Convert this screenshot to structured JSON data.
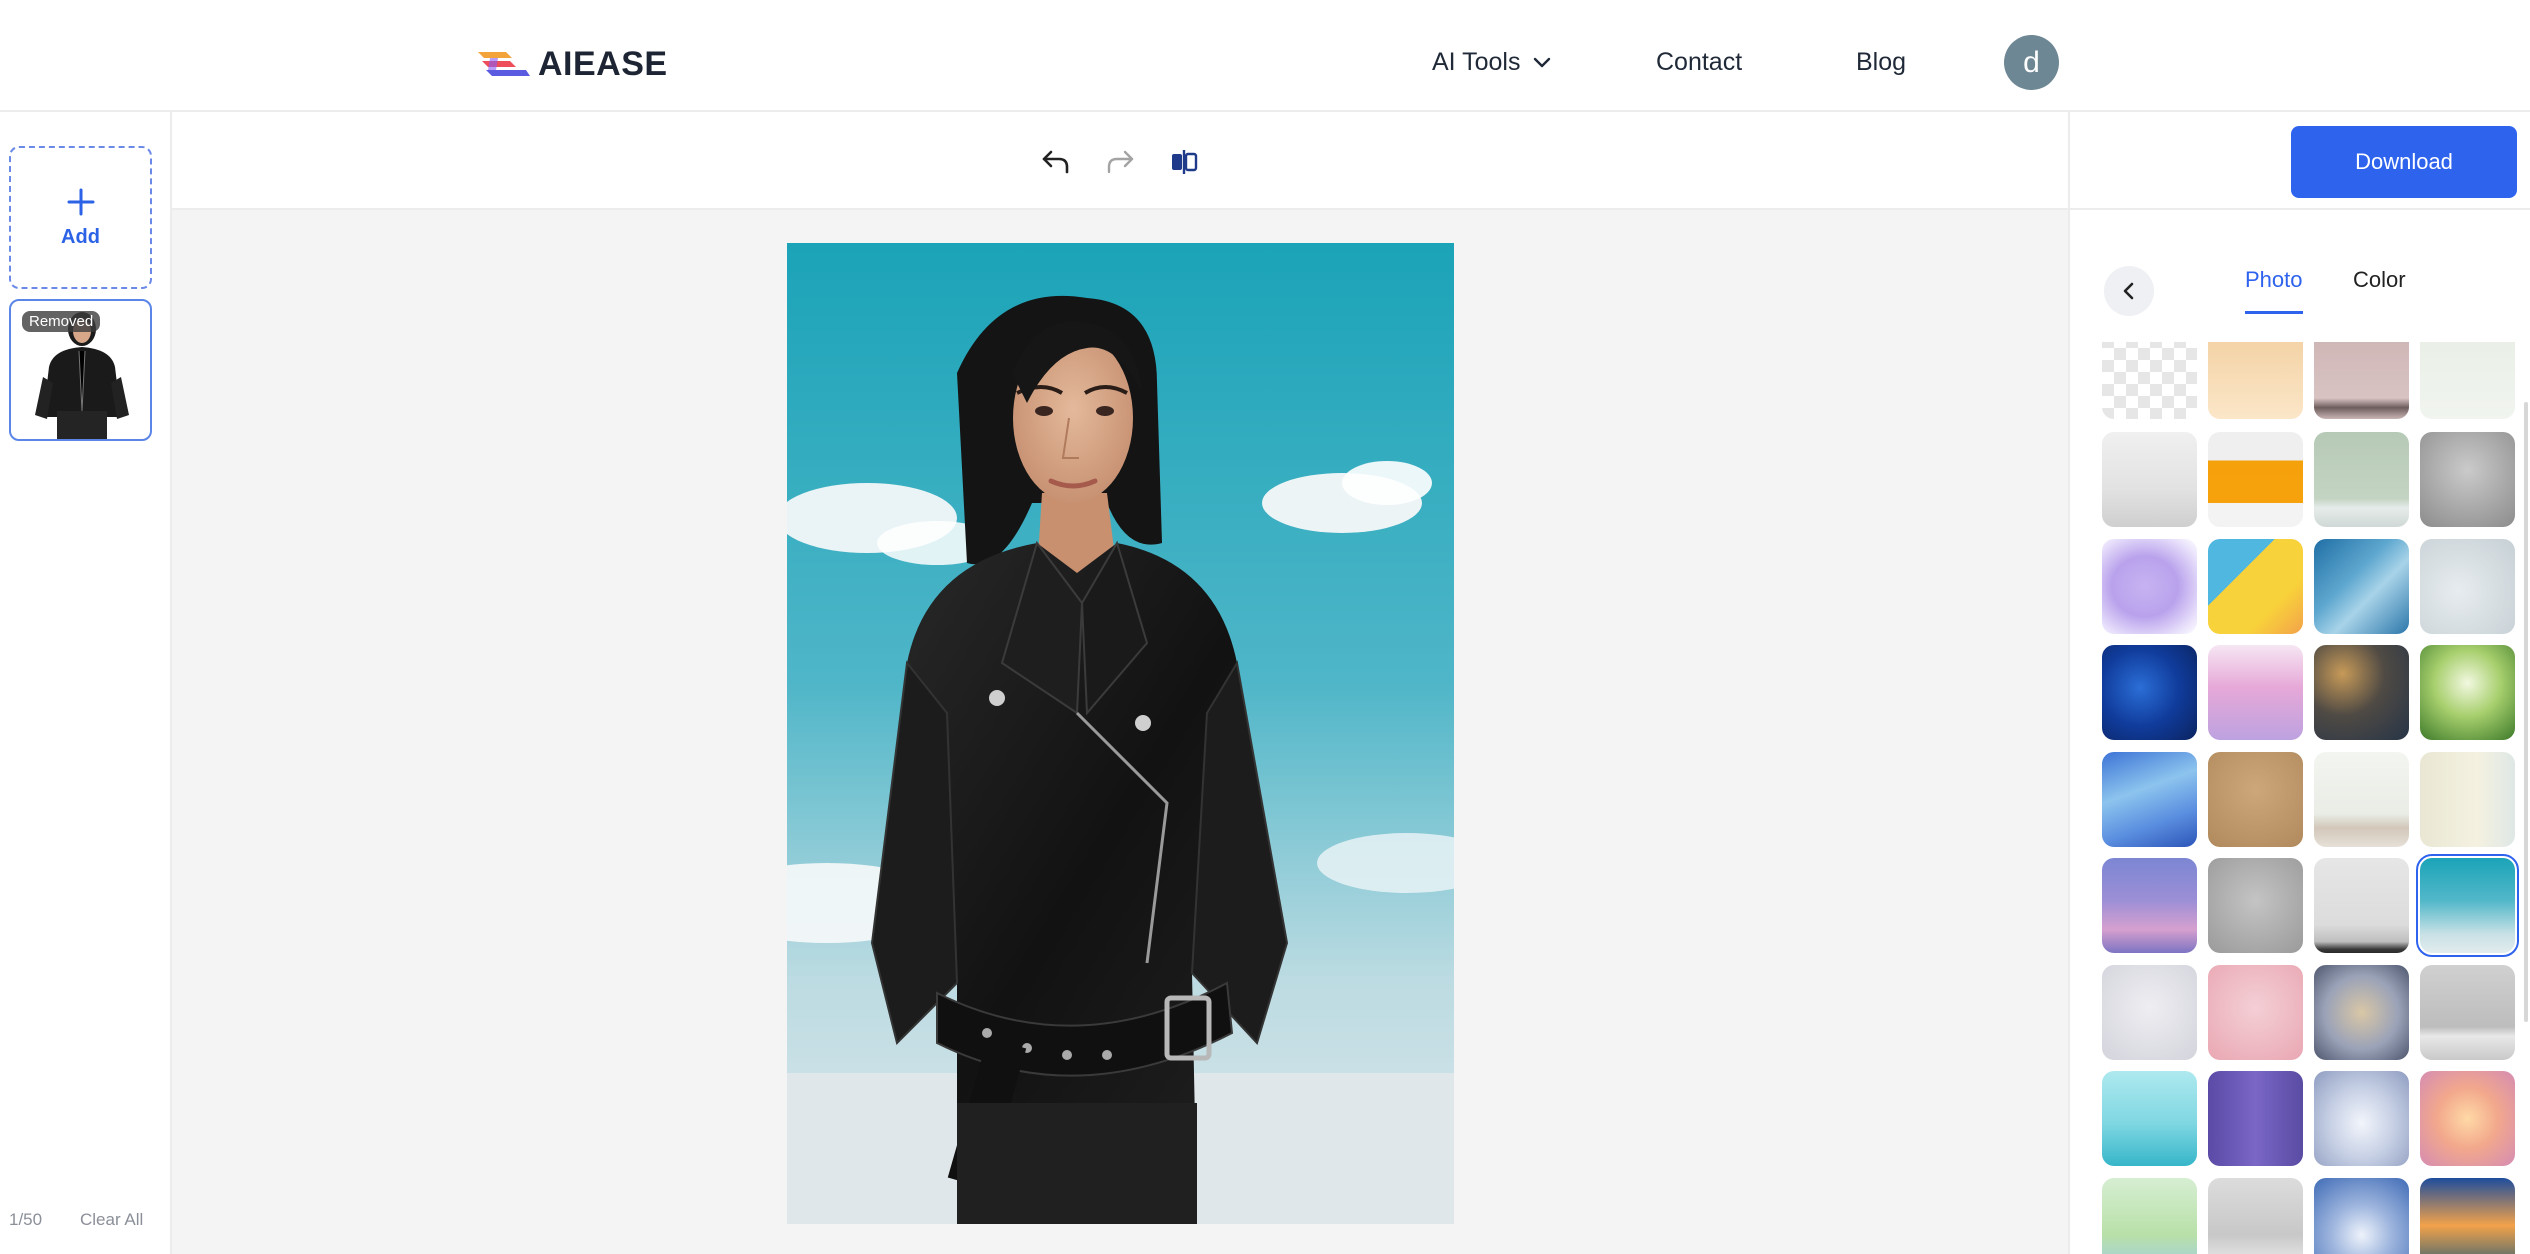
{
  "header": {
    "brand": "AIEASE",
    "nav": {
      "ai_tools": "AI Tools",
      "contact": "Contact",
      "blog": "Blog"
    },
    "avatar_initial": "d"
  },
  "left_panel": {
    "add_label": "Add",
    "thumb_badge": "Removed",
    "count": "1/50",
    "clear_all": "Clear All"
  },
  "toolbar": {
    "icons": [
      "undo-icon",
      "redo-icon",
      "compare-icon"
    ]
  },
  "right_panel": {
    "download_label": "Download",
    "tabs": {
      "photo": "Photo",
      "color": "Color"
    },
    "active_tab": "Photo",
    "selected_background": "sky-clouds"
  },
  "colors": {
    "accent": "#2e63ee",
    "avatar_bg": "#6e8794",
    "canvas_bg": "#f4f4f4"
  }
}
